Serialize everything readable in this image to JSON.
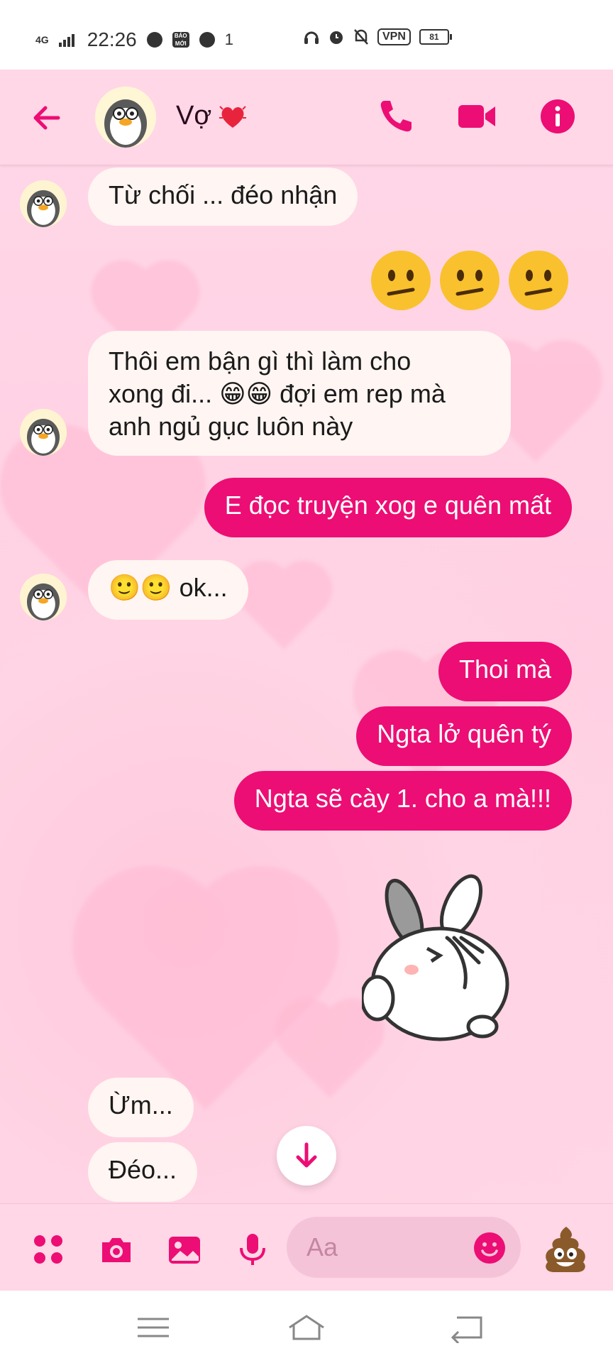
{
  "status_bar": {
    "network": "4G",
    "time": "22:26",
    "news_badge": "BÁO MỚI",
    "notification_count": "1",
    "vpn": "VPN",
    "battery": "81"
  },
  "header": {
    "contact_name": "Vợ",
    "name_emoji": "heart-with-sparkles-icon"
  },
  "messages": [
    {
      "side": "in",
      "text": "Từ chối ... đéo nhận"
    },
    {
      "side": "out",
      "emoji": "confused-face x3"
    },
    {
      "side": "in",
      "lines": [
        "Thôi em bận gì thì làm cho",
        "xong đi... 😁😁 đợi em rep mà",
        "anh ngủ gục luôn này"
      ]
    },
    {
      "side": "out",
      "text": "E đọc truyện xog e quên mất"
    },
    {
      "side": "in",
      "text": "🙂🙂 ok..."
    },
    {
      "side": "out",
      "text": "Thoi mà"
    },
    {
      "side": "out",
      "text": "Ngta lở quên tý"
    },
    {
      "side": "out",
      "text": "Ngta sẽ cày 1. cho a mà!!!"
    },
    {
      "side": "out",
      "sticker": "bunny-facepalm-sticker"
    },
    {
      "side": "in",
      "text": "Ừm..."
    },
    {
      "side": "in",
      "text": "Đéo..."
    }
  ],
  "composer": {
    "placeholder": "Aa"
  },
  "colors": {
    "accent": "#ec0e74",
    "background": "#ffd7e7",
    "incoming_bubble": "#fff5f2"
  }
}
